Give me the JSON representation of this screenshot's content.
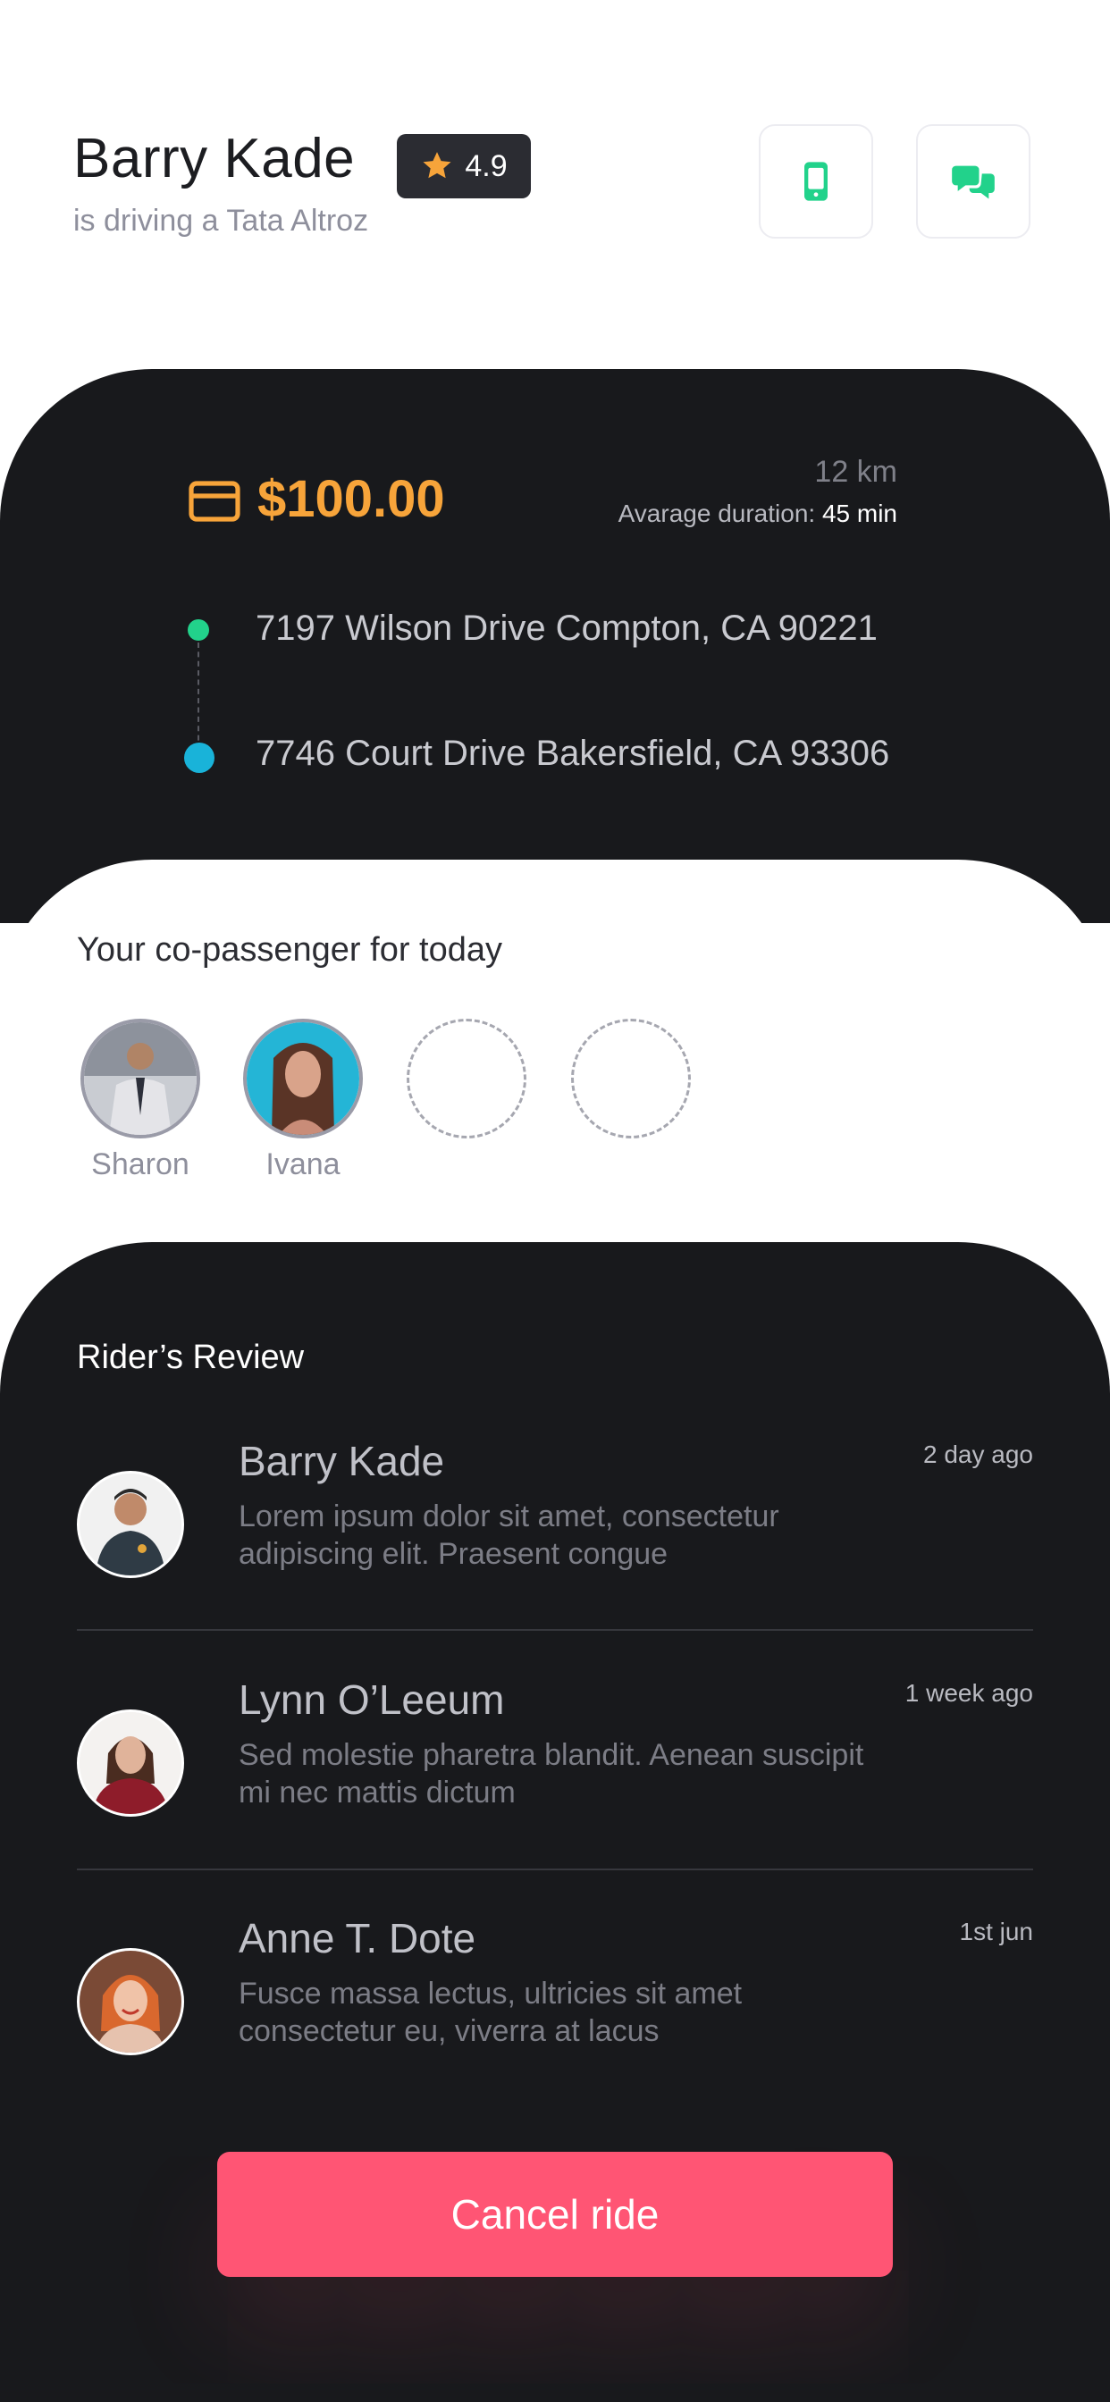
{
  "driver": {
    "name": "Barry Kade",
    "car_text": "is driving a Tata Altroz",
    "rating": "4.9"
  },
  "actions": {
    "call_icon": "phone-icon",
    "chat_icon": "chat-icon"
  },
  "ride": {
    "fare": "$100.00",
    "distance": "12 km",
    "duration_label": "Avarage duration:",
    "duration_value": "45 min",
    "from_address": "7197 Wilson Drive Compton, CA 90221",
    "to_address": "7746 Court Drive Bakersfield, CA 93306"
  },
  "copassengers": {
    "title": "Your co-passenger for today",
    "passengers": [
      {
        "name": "Sharon"
      },
      {
        "name": "Ivana"
      }
    ],
    "empty_seats": 2
  },
  "reviews": {
    "title": "Rider’s Review",
    "items": [
      {
        "name": "Barry Kade",
        "time": "2 day ago",
        "text": "Lorem ipsum dolor sit amet, consectetur adipiscing elit. Praesent congue"
      },
      {
        "name": "Lynn O’Leeum",
        "time": "1 week ago",
        "text": "Sed molestie pharetra blandit. Aenean suscipit mi nec mattis dictum"
      },
      {
        "name": "Anne T. Dote",
        "time": "1st jun",
        "text": "Fusce massa lectus, ultricies sit amet consectetur eu, viverra at lacus"
      }
    ]
  },
  "cancel_button": {
    "label": "Cancel ride"
  },
  "colors": {
    "accent_green": "#22d28b",
    "fare_orange": "#f7a43a",
    "route_blue": "#19b3d9",
    "cancel_red": "#ff5574",
    "dark_bg": "#18191c"
  }
}
